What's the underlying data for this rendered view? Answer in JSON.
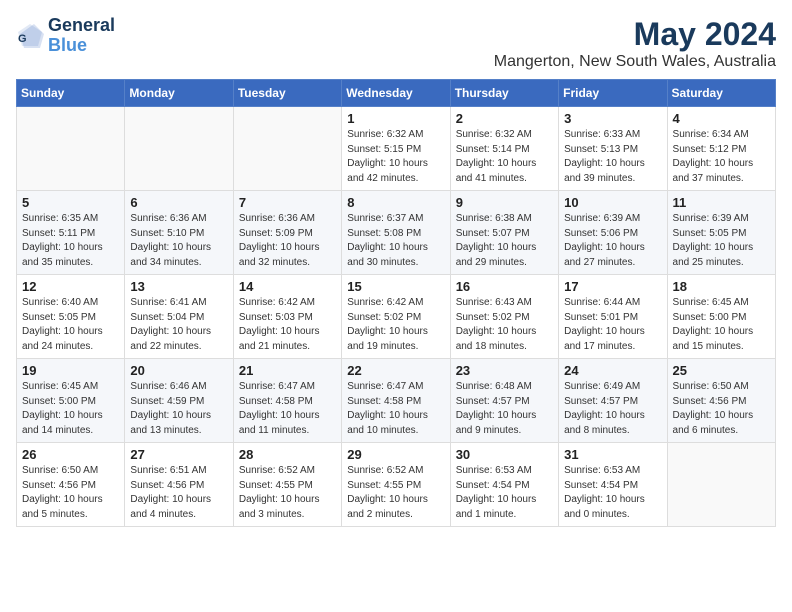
{
  "header": {
    "logo_line1": "General",
    "logo_line2": "Blue",
    "month_year": "May 2024",
    "location": "Mangerton, New South Wales, Australia"
  },
  "days_of_week": [
    "Sunday",
    "Monday",
    "Tuesday",
    "Wednesday",
    "Thursday",
    "Friday",
    "Saturday"
  ],
  "weeks": [
    [
      {
        "day": "",
        "info": ""
      },
      {
        "day": "",
        "info": ""
      },
      {
        "day": "",
        "info": ""
      },
      {
        "day": "1",
        "info": "Sunrise: 6:32 AM\nSunset: 5:15 PM\nDaylight: 10 hours\nand 42 minutes."
      },
      {
        "day": "2",
        "info": "Sunrise: 6:32 AM\nSunset: 5:14 PM\nDaylight: 10 hours\nand 41 minutes."
      },
      {
        "day": "3",
        "info": "Sunrise: 6:33 AM\nSunset: 5:13 PM\nDaylight: 10 hours\nand 39 minutes."
      },
      {
        "day": "4",
        "info": "Sunrise: 6:34 AM\nSunset: 5:12 PM\nDaylight: 10 hours\nand 37 minutes."
      }
    ],
    [
      {
        "day": "5",
        "info": "Sunrise: 6:35 AM\nSunset: 5:11 PM\nDaylight: 10 hours\nand 35 minutes."
      },
      {
        "day": "6",
        "info": "Sunrise: 6:36 AM\nSunset: 5:10 PM\nDaylight: 10 hours\nand 34 minutes."
      },
      {
        "day": "7",
        "info": "Sunrise: 6:36 AM\nSunset: 5:09 PM\nDaylight: 10 hours\nand 32 minutes."
      },
      {
        "day": "8",
        "info": "Sunrise: 6:37 AM\nSunset: 5:08 PM\nDaylight: 10 hours\nand 30 minutes."
      },
      {
        "day": "9",
        "info": "Sunrise: 6:38 AM\nSunset: 5:07 PM\nDaylight: 10 hours\nand 29 minutes."
      },
      {
        "day": "10",
        "info": "Sunrise: 6:39 AM\nSunset: 5:06 PM\nDaylight: 10 hours\nand 27 minutes."
      },
      {
        "day": "11",
        "info": "Sunrise: 6:39 AM\nSunset: 5:05 PM\nDaylight: 10 hours\nand 25 minutes."
      }
    ],
    [
      {
        "day": "12",
        "info": "Sunrise: 6:40 AM\nSunset: 5:05 PM\nDaylight: 10 hours\nand 24 minutes."
      },
      {
        "day": "13",
        "info": "Sunrise: 6:41 AM\nSunset: 5:04 PM\nDaylight: 10 hours\nand 22 minutes."
      },
      {
        "day": "14",
        "info": "Sunrise: 6:42 AM\nSunset: 5:03 PM\nDaylight: 10 hours\nand 21 minutes."
      },
      {
        "day": "15",
        "info": "Sunrise: 6:42 AM\nSunset: 5:02 PM\nDaylight: 10 hours\nand 19 minutes."
      },
      {
        "day": "16",
        "info": "Sunrise: 6:43 AM\nSunset: 5:02 PM\nDaylight: 10 hours\nand 18 minutes."
      },
      {
        "day": "17",
        "info": "Sunrise: 6:44 AM\nSunset: 5:01 PM\nDaylight: 10 hours\nand 17 minutes."
      },
      {
        "day": "18",
        "info": "Sunrise: 6:45 AM\nSunset: 5:00 PM\nDaylight: 10 hours\nand 15 minutes."
      }
    ],
    [
      {
        "day": "19",
        "info": "Sunrise: 6:45 AM\nSunset: 5:00 PM\nDaylight: 10 hours\nand 14 minutes."
      },
      {
        "day": "20",
        "info": "Sunrise: 6:46 AM\nSunset: 4:59 PM\nDaylight: 10 hours\nand 13 minutes."
      },
      {
        "day": "21",
        "info": "Sunrise: 6:47 AM\nSunset: 4:58 PM\nDaylight: 10 hours\nand 11 minutes."
      },
      {
        "day": "22",
        "info": "Sunrise: 6:47 AM\nSunset: 4:58 PM\nDaylight: 10 hours\nand 10 minutes."
      },
      {
        "day": "23",
        "info": "Sunrise: 6:48 AM\nSunset: 4:57 PM\nDaylight: 10 hours\nand 9 minutes."
      },
      {
        "day": "24",
        "info": "Sunrise: 6:49 AM\nSunset: 4:57 PM\nDaylight: 10 hours\nand 8 minutes."
      },
      {
        "day": "25",
        "info": "Sunrise: 6:50 AM\nSunset: 4:56 PM\nDaylight: 10 hours\nand 6 minutes."
      }
    ],
    [
      {
        "day": "26",
        "info": "Sunrise: 6:50 AM\nSunset: 4:56 PM\nDaylight: 10 hours\nand 5 minutes."
      },
      {
        "day": "27",
        "info": "Sunrise: 6:51 AM\nSunset: 4:56 PM\nDaylight: 10 hours\nand 4 minutes."
      },
      {
        "day": "28",
        "info": "Sunrise: 6:52 AM\nSunset: 4:55 PM\nDaylight: 10 hours\nand 3 minutes."
      },
      {
        "day": "29",
        "info": "Sunrise: 6:52 AM\nSunset: 4:55 PM\nDaylight: 10 hours\nand 2 minutes."
      },
      {
        "day": "30",
        "info": "Sunrise: 6:53 AM\nSunset: 4:54 PM\nDaylight: 10 hours\nand 1 minute."
      },
      {
        "day": "31",
        "info": "Sunrise: 6:53 AM\nSunset: 4:54 PM\nDaylight: 10 hours\nand 0 minutes."
      },
      {
        "day": "",
        "info": ""
      }
    ]
  ]
}
